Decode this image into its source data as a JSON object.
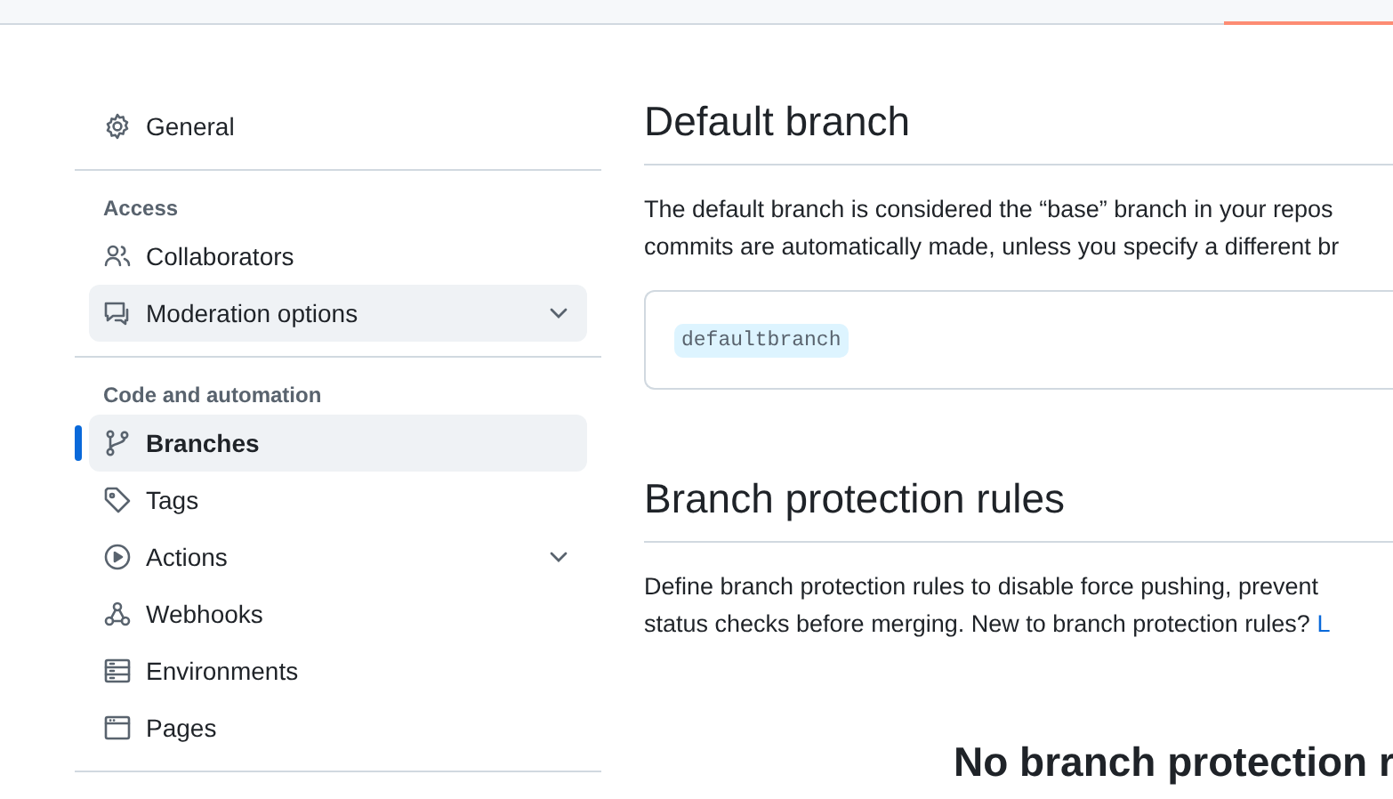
{
  "sidebar": {
    "groups": [
      {
        "items": [
          {
            "label": "General",
            "selected": false,
            "highlighted": false,
            "has_submenu": false
          }
        ]
      },
      {
        "heading": "Access",
        "items": [
          {
            "label": "Collaborators",
            "selected": false,
            "highlighted": false,
            "has_submenu": false
          },
          {
            "label": "Moderation options",
            "selected": false,
            "highlighted": true,
            "has_submenu": true
          }
        ]
      },
      {
        "heading": "Code and automation",
        "items": [
          {
            "label": "Branches",
            "selected": true,
            "highlighted": false,
            "has_submenu": false
          },
          {
            "label": "Tags",
            "selected": false,
            "highlighted": false,
            "has_submenu": false
          },
          {
            "label": "Actions",
            "selected": false,
            "highlighted": false,
            "has_submenu": true
          },
          {
            "label": "Webhooks",
            "selected": false,
            "highlighted": false,
            "has_submenu": false
          },
          {
            "label": "Environments",
            "selected": false,
            "highlighted": false,
            "has_submenu": false
          },
          {
            "label": "Pages",
            "selected": false,
            "highlighted": false,
            "has_submenu": false
          }
        ]
      }
    ]
  },
  "default_branch": {
    "title": "Default branch",
    "description_lines": [
      "The default branch is considered the “base” branch in your repos",
      "commits are automatically made, unless you specify a different br"
    ],
    "branch_name": "defaultbranch"
  },
  "branch_protection": {
    "title": "Branch protection rules",
    "description_lines": [
      "Define branch protection rules to disable force pushing, prevent",
      "status checks before merging. New to branch protection rules?"
    ],
    "link": "L",
    "empty_title": "No branch protection r"
  }
}
